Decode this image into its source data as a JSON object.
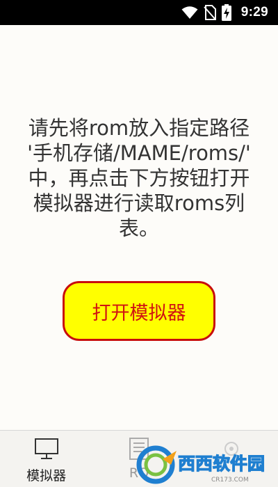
{
  "status_bar": {
    "time": "9:29",
    "icons": [
      "wifi-icon",
      "no-sim-icon",
      "battery-charging-icon"
    ]
  },
  "message": {
    "lines": [
      "请先将rom放入指定路径",
      "'手机存储/MAME/roms/'",
      "中，再点击下方按钮打开",
      "模拟器进行读取roms列",
      "表。"
    ]
  },
  "open_button": {
    "label": "打开模拟器",
    "background": "#ffff00",
    "border_color": "#c80e0e",
    "text_color": "#d01212"
  },
  "bottom_nav": {
    "items": [
      {
        "label": "模拟器",
        "icon": "monitor-icon",
        "active": true
      },
      {
        "label": "RO",
        "icon": "rom-icon",
        "active": false
      },
      {
        "label": "",
        "icon": "settings-icon",
        "active": false
      }
    ]
  },
  "watermark": {
    "brand": "西西软件园",
    "url": "CR173.COM"
  }
}
